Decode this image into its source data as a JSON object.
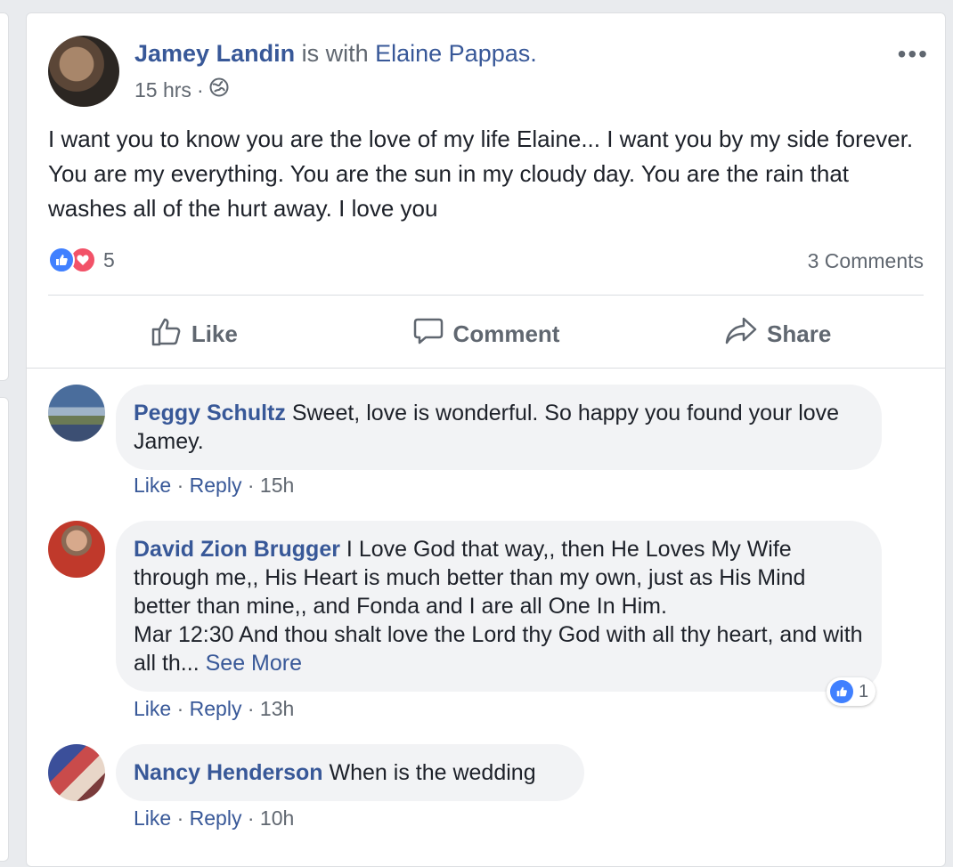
{
  "post": {
    "author": "Jamey Landin",
    "with_text": "is with",
    "tagged": "Elaine Pappas",
    "period": ".",
    "time": "15 hrs",
    "dot": "·",
    "privacy_icon": "globe-icon",
    "more": "•••",
    "text": "I want you to know you are the love of my life Elaine... I want you by my side forever. You are my everything. You are the sun in my cloudy day. You are the rain that washes all of the hurt away. I love you",
    "reaction_count": "5",
    "comments_count": "3 Comments",
    "actions": {
      "like": "Like",
      "comment": "Comment",
      "share": "Share"
    }
  },
  "comments": [
    {
      "name": "Peggy Schultz",
      "text": "Sweet, love is wonderful. So happy you found your love Jamey.",
      "like": "Like",
      "reply": "Reply",
      "time": "15h",
      "sep": "·"
    },
    {
      "name": "David Zion Brugger",
      "text": "I Love God that way,, then He Loves My Wife through me,, His Heart is much better than my own, just as His Mind better than mine,, and Fonda and I are all One In Him.",
      "text2": "Mar 12:30 And thou shalt love the Lord thy God with all thy heart, and with all th...",
      "see_more": "See More",
      "like": "Like",
      "reply": "Reply",
      "time": "13h",
      "sep": "·",
      "reaction_count": "1"
    },
    {
      "name": "Nancy Henderson",
      "text": "When is the wedding",
      "like": "Like",
      "reply": "Reply",
      "time": "10h",
      "sep": "·"
    }
  ],
  "colors": {
    "link": "#385898",
    "like_blue": "#4080ff",
    "love_red": "#f25268",
    "muted": "#606770"
  }
}
